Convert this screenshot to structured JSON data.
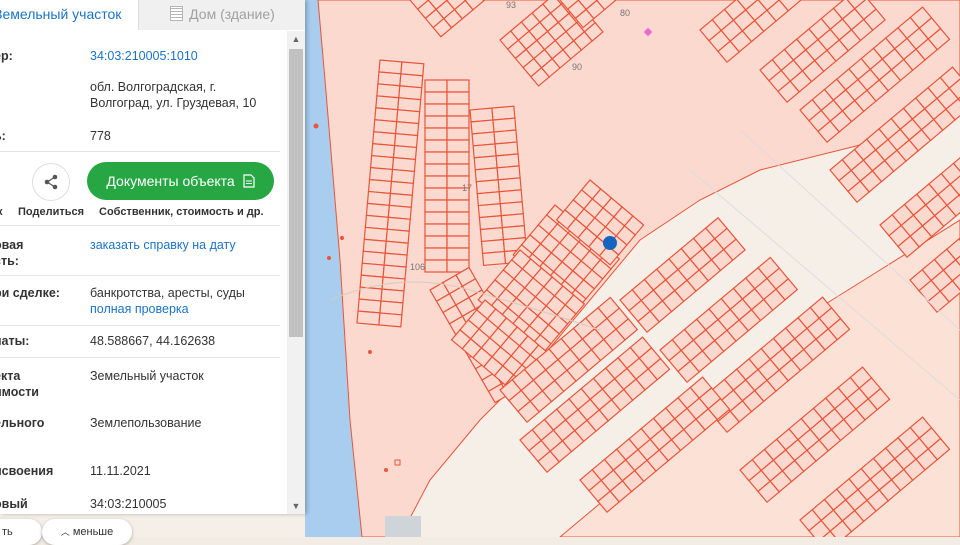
{
  "tabs": {
    "active": "Земельный участок",
    "inactive": "Дом (здание)"
  },
  "fields": {
    "cad_number_label": "ер:",
    "cad_number_value": "34:03:210005:1010",
    "address_value": "обл. Волгоградская, г. Волгоград, ул. Груздевая, 10",
    "area_label": "ь:",
    "area_value": "778",
    "share_caption": "Поделиться",
    "left_caption": "к",
    "docs_button": "Документы объекта",
    "docs_caption": "Собственник, стоимость и др.",
    "cost_label_1": "овая",
    "cost_label_2": "сть:",
    "cost_link": "заказать справку на дату",
    "deal_label": "ри сделке:",
    "deal_value": "банкротства, аресты, суды",
    "deal_link": "полная проверка",
    "coords_label": "наты:",
    "coords_value": "48.588667, 44.162638",
    "type_label_1": "екта",
    "type_label_2": "имости",
    "type_value": "Земельный участок",
    "use_label": "ельного",
    "use_value": "Землепользование",
    "date_label": "исвоения",
    "date_value": "11.11.2021",
    "quarter_label": "овый",
    "quarter_value": "34:03:210005"
  },
  "bottom": {
    "pill_left": "ть",
    "pill_less": "меньше"
  },
  "map": {
    "labels": [
      "93",
      "80",
      "90",
      "17",
      "106"
    ],
    "colors": {
      "parcel_fill": "#fbd9cf",
      "parcel_stroke": "#e8553a",
      "water": "#9cc6ea",
      "road": "#f6f2ec",
      "pin": "#1565c0"
    }
  },
  "icons": [
    "share-icon",
    "document-icon",
    "building-icon",
    "chevron-up-icon",
    "chevron-down-icon"
  ]
}
